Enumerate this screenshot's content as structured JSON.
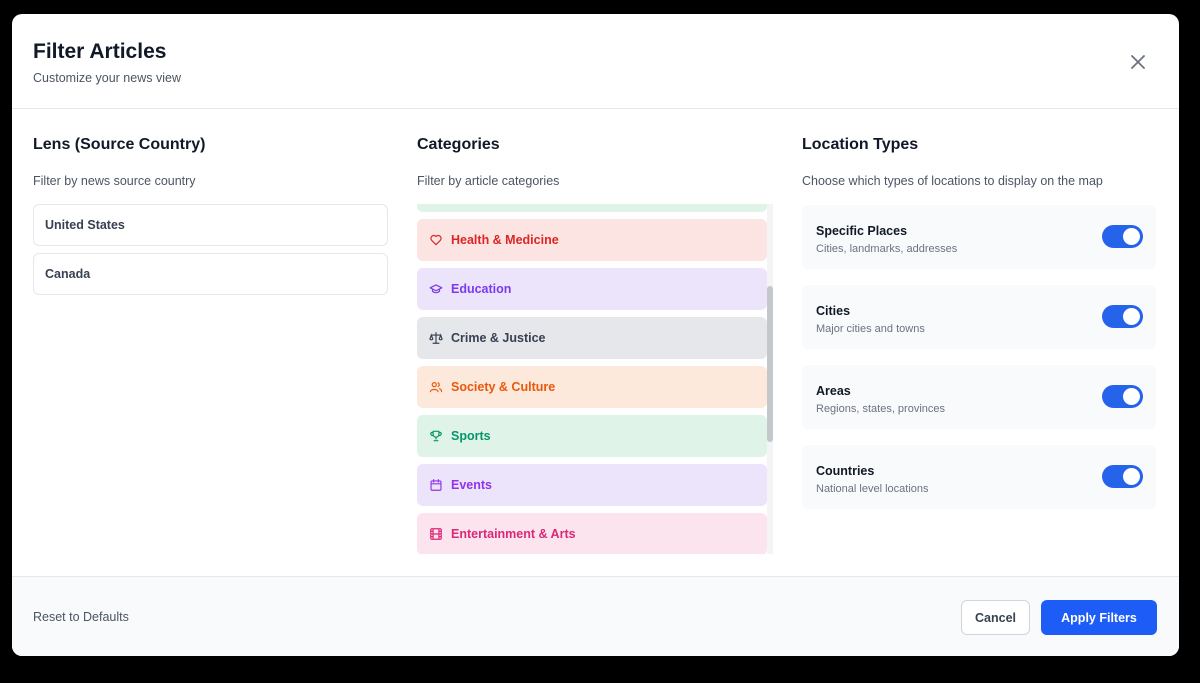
{
  "header": {
    "title": "Filter Articles",
    "subtitle": "Customize your news view"
  },
  "lens": {
    "title": "Lens (Source Country)",
    "description": "Filter by news source country",
    "countries": [
      "United States",
      "Canada"
    ]
  },
  "categories": {
    "title": "Categories",
    "description": "Filter by article categories",
    "items": [
      {
        "label": "Health & Medicine",
        "icon": "heart-icon",
        "bg": "#fce4e2",
        "fg": "#dc2626"
      },
      {
        "label": "Education",
        "icon": "graduation-cap-icon",
        "bg": "#ece4fb",
        "fg": "#7c3aed"
      },
      {
        "label": "Crime & Justice",
        "icon": "scale-icon",
        "bg": "#e5e7eb",
        "fg": "#374151"
      },
      {
        "label": "Society & Culture",
        "icon": "users-icon",
        "bg": "#fde8dc",
        "fg": "#ea580c"
      },
      {
        "label": "Sports",
        "icon": "trophy-icon",
        "bg": "#dff3e9",
        "fg": "#059669"
      },
      {
        "label": "Events",
        "icon": "calendar-icon",
        "bg": "#ece4fb",
        "fg": "#9333ea"
      },
      {
        "label": "Entertainment & Arts",
        "icon": "film-icon",
        "bg": "#fce4ef",
        "fg": "#db2777"
      }
    ]
  },
  "locations": {
    "title": "Location Types",
    "description": "Choose which types of locations to display on the map",
    "items": [
      {
        "title": "Specific Places",
        "desc": "Cities, landmarks, addresses",
        "enabled": true
      },
      {
        "title": "Cities",
        "desc": "Major cities and towns",
        "enabled": true
      },
      {
        "title": "Areas",
        "desc": "Regions, states, provinces",
        "enabled": true
      },
      {
        "title": "Countries",
        "desc": "National level locations",
        "enabled": true
      }
    ]
  },
  "footer": {
    "reset_label": "Reset to Defaults",
    "cancel_label": "Cancel",
    "apply_label": "Apply Filters"
  },
  "colors": {
    "accent": "#1d5cf6",
    "toggle_on": "#2563eb"
  }
}
